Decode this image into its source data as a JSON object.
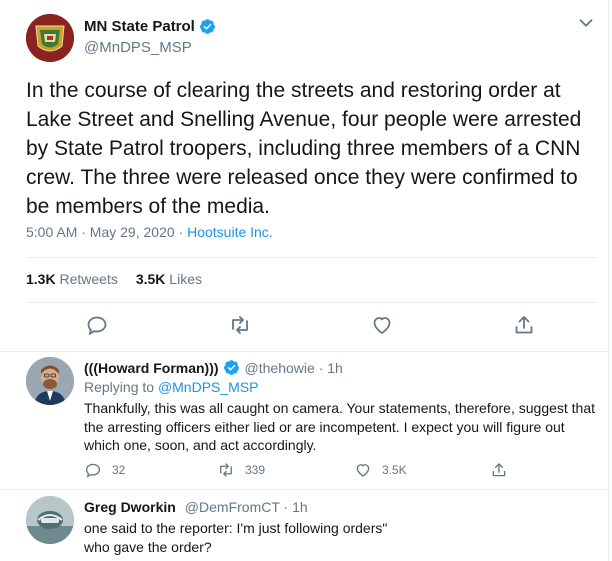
{
  "main_tweet": {
    "author_name": "MN State Patrol",
    "author_handle": "@MnDPS_MSP",
    "text": "In the course of clearing the streets and restoring order at Lake Street and Snelling Avenue, four people were arrested by State Patrol troopers, including three members of a CNN crew. The three were released once they were confirmed to be members of the media.",
    "timestamp": "5:00 AM · May 29, 2020",
    "separator": " · ",
    "source": "Hootsuite Inc.",
    "retweets_count": "1.3K",
    "retweets_label": "Retweets",
    "likes_count": "3.5K",
    "likes_label": "Likes"
  },
  "replies": [
    {
      "name": "(((Howard Forman)))",
      "handle": "@thehowie · 1h",
      "replying_prefix": "Replying to ",
      "replying_to": "@MnDPS_MSP",
      "text": "Thankfully, this was all caught on camera. Your statements, therefore, suggest that the arresting officers either lied or are incompetent. I expect you will figure out which one, soon, and act accordingly.",
      "reply_count": "32",
      "retweet_count": "339",
      "like_count": "3.5K"
    },
    {
      "name": "Greg Dworkin",
      "handle": "@DemFromCT · 1h",
      "line1": "one said to the reporter: I'm just following orders\"",
      "line2": "who gave the order?"
    }
  ],
  "colors": {
    "accent": "#1b95e0",
    "secondary_text": "#657786",
    "divider": "#e6ecf0"
  },
  "icons": [
    "verified-icon",
    "chevron-down-icon",
    "reply-icon",
    "retweet-icon",
    "like-icon",
    "share-icon"
  ]
}
